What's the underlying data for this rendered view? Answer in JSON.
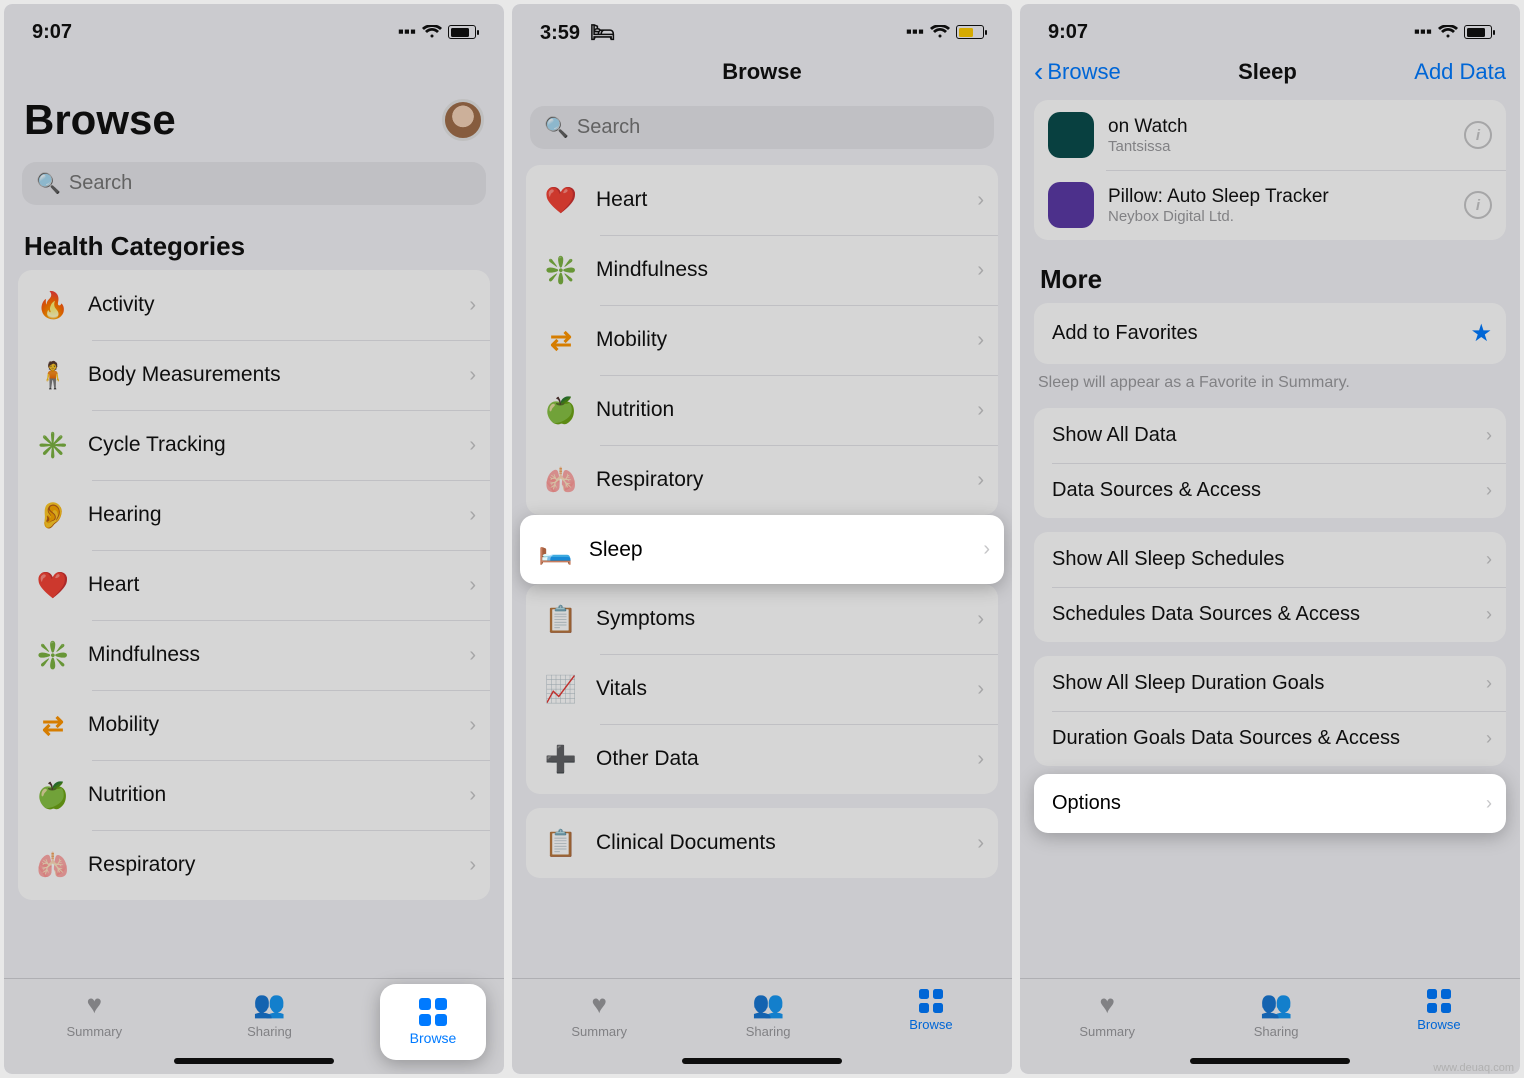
{
  "screens": {
    "s1": {
      "time": "9:07",
      "title": "Browse",
      "search_placeholder": "Search",
      "section": "Health Categories",
      "categories": [
        {
          "label": "Activity",
          "icon": "🔥",
          "color": "#ff3b30"
        },
        {
          "label": "Body Measurements",
          "icon": "🧍",
          "color": "#af52de"
        },
        {
          "label": "Cycle Tracking",
          "icon": "✳️",
          "color": "#ff2d55"
        },
        {
          "label": "Hearing",
          "icon": "👂",
          "color": "#0a84ff"
        },
        {
          "label": "Heart",
          "icon": "❤️",
          "color": "#ff2d55"
        },
        {
          "label": "Mindfulness",
          "icon": "❇️",
          "color": "#32d2c8"
        },
        {
          "label": "Mobility",
          "icon": "⇄",
          "color": "#ff9500"
        },
        {
          "label": "Nutrition",
          "icon": "🍏",
          "color": "#32d74b"
        },
        {
          "label": "Respiratory",
          "icon": "🫁",
          "color": "#0a84ff"
        }
      ],
      "tabs": {
        "summary": "Summary",
        "sharing": "Sharing",
        "browse": "Browse"
      }
    },
    "s2": {
      "time": "3:59",
      "title": "Browse",
      "search_placeholder": "Search",
      "categories_top": [
        {
          "label": "Heart",
          "icon": "❤️"
        },
        {
          "label": "Mindfulness",
          "icon": "❇️"
        },
        {
          "label": "Mobility",
          "icon": "⇄"
        },
        {
          "label": "Nutrition",
          "icon": "🍏"
        },
        {
          "label": "Respiratory",
          "icon": "🫁"
        }
      ],
      "sleep": {
        "label": "Sleep",
        "icon": "🛏️"
      },
      "categories_bottom": [
        {
          "label": "Symptoms",
          "icon": "📋"
        },
        {
          "label": "Vitals",
          "icon": "📈"
        },
        {
          "label": "Other Data",
          "icon": "➕"
        }
      ],
      "records": {
        "label": "Clinical Documents",
        "icon": "📋"
      },
      "tabs": {
        "summary": "Summary",
        "sharing": "Sharing",
        "browse": "Browse"
      }
    },
    "s3": {
      "time": "9:07",
      "back": "Browse",
      "title": "Sleep",
      "action": "Add Data",
      "apps": [
        {
          "name": "on Watch",
          "sub": "Tantsissa",
          "color": "#0a4d4d"
        },
        {
          "name": "Pillow: Auto Sleep Tracker",
          "sub": "Neybox Digital Ltd.",
          "color": "#5b3aa6"
        }
      ],
      "more_header": "More",
      "favorites": {
        "label": "Add to Favorites",
        "hint": "Sleep will appear as a Favorite in Summary."
      },
      "rows1": [
        "Show All Data",
        "Data Sources & Access"
      ],
      "rows2": [
        "Show All Sleep Schedules",
        "Schedules Data Sources & Access"
      ],
      "rows3": [
        "Show All Sleep Duration Goals",
        "Duration Goals Data Sources & Access"
      ],
      "options": "Options",
      "tabs": {
        "summary": "Summary",
        "sharing": "Sharing",
        "browse": "Browse"
      }
    }
  },
  "watermark": "www.deuaq.com"
}
